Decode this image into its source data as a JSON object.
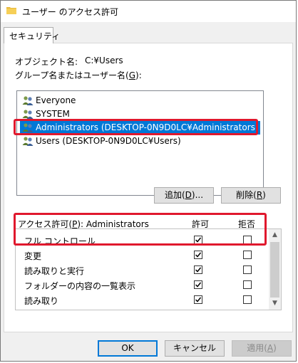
{
  "window": {
    "title": "ユーザー のアクセス許可"
  },
  "tabs": [
    {
      "label": "セキュリティ"
    }
  ],
  "object_name": {
    "label": "オブジェクト名:",
    "value": "C:¥Users"
  },
  "group_label": {
    "pre": "グループ名またはユーザー名(",
    "key": "G",
    "post": "):"
  },
  "users": [
    {
      "name": "Everyone",
      "selected": false
    },
    {
      "name": "SYSTEM",
      "selected": false
    },
    {
      "name": "Administrators (DESKTOP-0N9D0LC¥Administrators)",
      "selected": true
    },
    {
      "name": "Users (DESKTOP-0N9D0LC¥Users)",
      "selected": false
    }
  ],
  "buttons": {
    "add": {
      "pre": "追加(",
      "key": "D",
      "post": ")..."
    },
    "remove": {
      "pre": "削除(",
      "key": "R",
      "post": ")"
    },
    "ok": "OK",
    "cancel": "キャンセル",
    "apply": {
      "pre": "適用(",
      "key": "A",
      "post": ")"
    }
  },
  "permissions": {
    "header_pre": "アクセス許可(",
    "header_key": "P",
    "header_post": "): Administrators",
    "allow_label": "許可",
    "deny_label": "拒否",
    "rows": [
      {
        "name": "フル コントロール",
        "allow": true,
        "deny": false
      },
      {
        "name": "変更",
        "allow": true,
        "deny": false
      },
      {
        "name": "読み取りと実行",
        "allow": true,
        "deny": false
      },
      {
        "name": "フォルダーの内容の一覧表示",
        "allow": true,
        "deny": false
      },
      {
        "name": "読み取り",
        "allow": true,
        "deny": false
      }
    ]
  },
  "colors": {
    "accent": "#0078d7",
    "highlight": "#e0182d"
  }
}
